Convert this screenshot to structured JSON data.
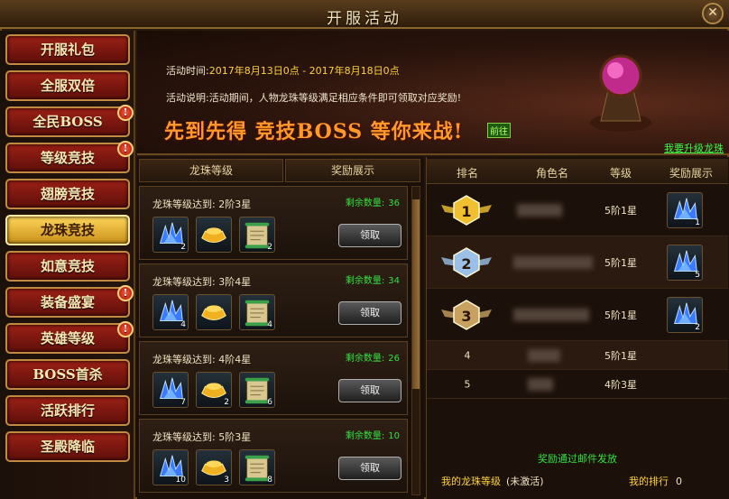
{
  "window": {
    "title": "开服活动",
    "close_symbol": "✕"
  },
  "sidebar": {
    "items": [
      {
        "label": "开服礼包",
        "badge": ""
      },
      {
        "label": "全服双倍",
        "badge": ""
      },
      {
        "label": "全民BOSS",
        "badge": "!"
      },
      {
        "label": "等级竞技",
        "badge": "!"
      },
      {
        "label": "翅膀竞技",
        "badge": ""
      },
      {
        "label": "龙珠竞技",
        "badge": "",
        "active": true
      },
      {
        "label": "如意竞技",
        "badge": ""
      },
      {
        "label": "装备盛宴",
        "badge": "!"
      },
      {
        "label": "英雄等级",
        "badge": "!"
      },
      {
        "label": "BOSS首杀",
        "badge": ""
      },
      {
        "label": "活跃排行",
        "badge": ""
      },
      {
        "label": "圣殿降临",
        "badge": ""
      }
    ]
  },
  "banner": {
    "time_label": "活动时间:",
    "time_value": "2017年8月13日0点 - 2017年8月18日0点",
    "desc_label": "活动说明:",
    "desc_value": "活动期间，人物龙珠等级满足相应条件即可领取对应奖励!",
    "slogan": "先到先得  竞技BOSS  等你来战!",
    "slogan_tag": "前往",
    "upgrade_link": "我要升级龙珠"
  },
  "reward_list": {
    "headers": [
      "龙珠等级",
      "奖励展示"
    ],
    "claim_label": "领取",
    "remain_label": "剩余数量:",
    "tiers": [
      {
        "condition": "龙珠等级达到: 2阶3星",
        "remain": "36",
        "items": [
          {
            "icon": "crystal-icon",
            "count": "2"
          },
          {
            "icon": "gold-ingot-icon",
            "count": ""
          },
          {
            "icon": "scroll-icon",
            "count": "2"
          }
        ]
      },
      {
        "condition": "龙珠等级达到: 3阶4星",
        "remain": "34",
        "items": [
          {
            "icon": "crystal-icon",
            "count": "4"
          },
          {
            "icon": "gold-ingot-icon",
            "count": ""
          },
          {
            "icon": "scroll-icon",
            "count": "4"
          }
        ]
      },
      {
        "condition": "龙珠等级达到: 4阶4星",
        "remain": "26",
        "items": [
          {
            "icon": "crystal-icon",
            "count": "7"
          },
          {
            "icon": "gold-ingot-icon",
            "count": "2"
          },
          {
            "icon": "scroll-icon",
            "count": "6"
          }
        ]
      },
      {
        "condition": "龙珠等级达到: 5阶3星",
        "remain": "10",
        "items": [
          {
            "icon": "crystal-icon",
            "count": "10"
          },
          {
            "icon": "gold-ingot-icon",
            "count": "3"
          },
          {
            "icon": "scroll-icon",
            "count": "8"
          }
        ]
      }
    ]
  },
  "ranking": {
    "headers": {
      "rank": "排名",
      "name": "角色名",
      "level": "等级",
      "reward": "奖励展示"
    },
    "rows": [
      {
        "rank": "1",
        "level": "5阶1星",
        "reward_count": "1"
      },
      {
        "rank": "2",
        "level": "5阶1星",
        "reward_count": "5"
      },
      {
        "rank": "3",
        "level": "5阶1星",
        "reward_count": "2"
      },
      {
        "rank": "4",
        "level": "5阶1星",
        "reward_count": ""
      },
      {
        "rank": "5",
        "level": "4阶3星",
        "reward_count": ""
      }
    ],
    "mail_note": "奖励通过邮件发放",
    "my_level_label": "我的龙珠等级",
    "my_level_status": "(未激活)",
    "my_rank_label": "我的排行",
    "my_rank_value": "0"
  }
}
